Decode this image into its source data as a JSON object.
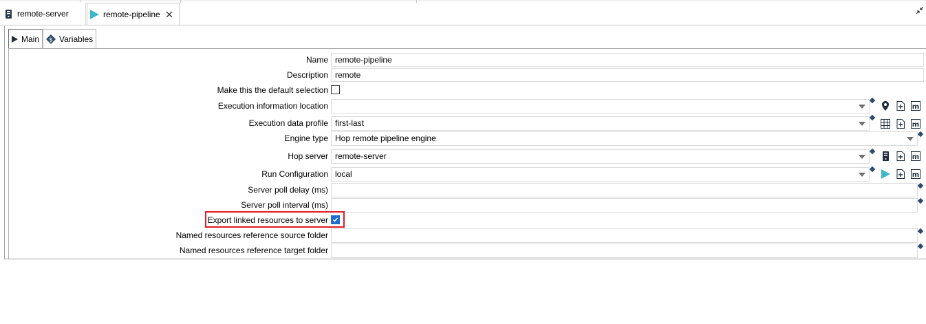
{
  "tabs": {
    "server_tab": "remote-server",
    "pipeline_tab": "remote-pipeline"
  },
  "subtabs": {
    "main": "Main",
    "variables": "Variables"
  },
  "form": {
    "name_label": "Name",
    "name_value": "remote-pipeline",
    "description_label": "Description",
    "description_value": "remote",
    "default_label": "Make this the default selection",
    "default_checked": false,
    "exec_info_label": "Execution information location",
    "exec_info_value": "",
    "exec_profile_label": "Execution data profile",
    "exec_profile_value": "first-last",
    "engine_label": "Engine type",
    "engine_value": "Hop remote pipeline engine",
    "hop_server_label": "Hop server",
    "hop_server_value": "remote-server",
    "run_config_label": "Run Configuration",
    "run_config_value": "local",
    "poll_delay_label": "Server poll delay (ms)",
    "poll_delay_value": "",
    "poll_interval_label": "Server poll interval (ms)",
    "poll_interval_value": "",
    "export_label": "Export linked resources to server",
    "export_checked": true,
    "named_source_label": "Named resources reference source folder",
    "named_source_value": "",
    "named_target_label": "Named resources reference target folder",
    "named_target_value": ""
  },
  "colors": {
    "accent": "#1e6fd0",
    "highlight": "#e01b24",
    "variable_marker": "#2e4b6b",
    "pipeline_icon": "#3fb7c9"
  }
}
